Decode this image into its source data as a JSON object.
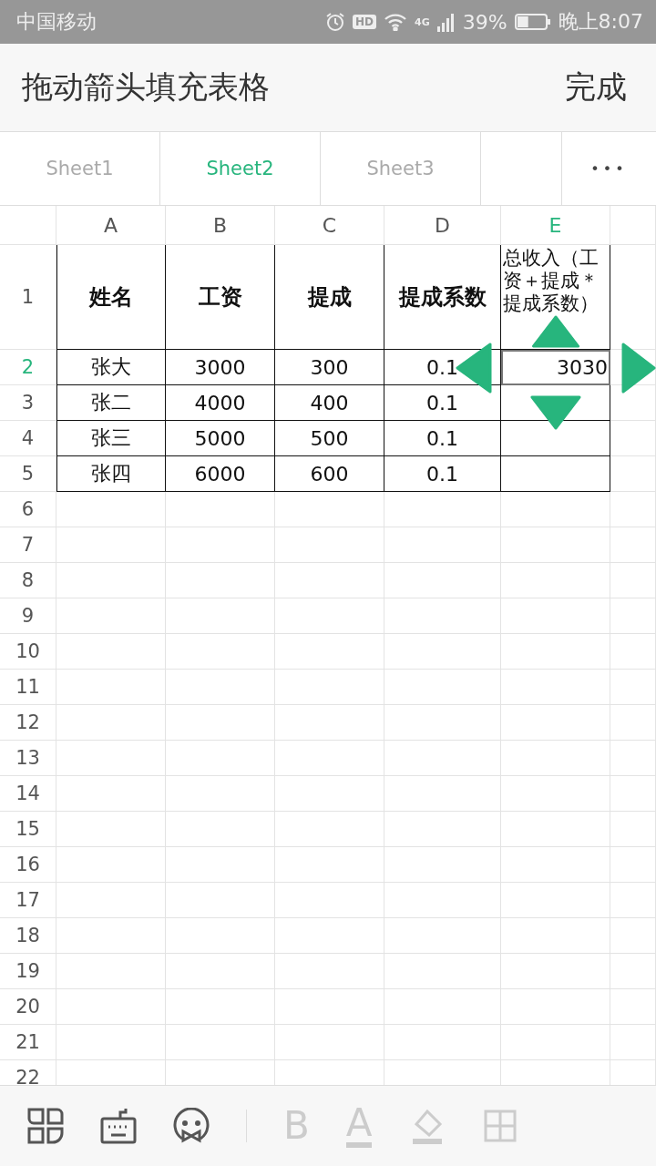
{
  "status_bar": {
    "carrier": "中国移动",
    "hd": "HD",
    "network": "4G",
    "battery_text": "39%",
    "battery": {
      "level": 0.39
    },
    "time": "晚上8:07"
  },
  "header": {
    "title": "拖动箭头填充表格",
    "done": "完成"
  },
  "tabs": [
    {
      "label": "Sheet1",
      "selected": false
    },
    {
      "label": "Sheet2",
      "selected": true
    },
    {
      "label": "Sheet3",
      "selected": false
    }
  ],
  "more": "•••",
  "table": {
    "columns": [
      {
        "label": "A",
        "selected": false
      },
      {
        "label": "B",
        "selected": false
      },
      {
        "label": "C",
        "selected": false
      },
      {
        "label": "D",
        "selected": false
      },
      {
        "label": "E",
        "selected": true
      }
    ],
    "rows": [
      {
        "label": "1",
        "selected": false,
        "bordered": true,
        "kind": "header",
        "cells": [
          {
            "text": "姓名"
          },
          {
            "text": "工资"
          },
          {
            "text": "提成"
          },
          {
            "text": "提成系数"
          },
          {
            "text": "总收入（工资＋提成＊提成系数）"
          }
        ]
      },
      {
        "label": "2",
        "selected": true,
        "bordered": true,
        "kind": "data",
        "cells": [
          {
            "text": "张大"
          },
          {
            "text": "3000"
          },
          {
            "text": "300"
          },
          {
            "text": "0.1"
          },
          {
            "text": "3030",
            "selected": true
          }
        ]
      },
      {
        "label": "3",
        "selected": false,
        "bordered": true,
        "kind": "data",
        "cells": [
          {
            "text": "张二"
          },
          {
            "text": "4000"
          },
          {
            "text": "400"
          },
          {
            "text": "0.1"
          }
        ]
      },
      {
        "label": "4",
        "selected": false,
        "bordered": true,
        "kind": "data",
        "cells": [
          {
            "text": "张三"
          },
          {
            "text": "5000"
          },
          {
            "text": "500"
          },
          {
            "text": "0.1"
          }
        ]
      },
      {
        "label": "5",
        "selected": false,
        "bordered": true,
        "kind": "data",
        "cells": [
          {
            "text": "张四"
          },
          {
            "text": "6000"
          },
          {
            "text": "600"
          },
          {
            "text": "0.1"
          }
        ]
      },
      {
        "label": "6",
        "selected": false,
        "bordered": false,
        "kind": "data",
        "cells": []
      },
      {
        "label": "7",
        "selected": false,
        "bordered": false,
        "kind": "data",
        "cells": []
      },
      {
        "label": "8",
        "selected": false,
        "bordered": false,
        "kind": "data",
        "cells": []
      },
      {
        "label": "9",
        "selected": false,
        "bordered": false,
        "kind": "data",
        "cells": []
      },
      {
        "label": "10",
        "selected": false,
        "bordered": false,
        "kind": "data",
        "cells": []
      },
      {
        "label": "11",
        "selected": false,
        "bordered": false,
        "kind": "data",
        "cells": []
      },
      {
        "label": "12",
        "selected": false,
        "bordered": false,
        "kind": "data",
        "cells": []
      },
      {
        "label": "13",
        "selected": false,
        "bordered": false,
        "kind": "data",
        "cells": []
      },
      {
        "label": "14",
        "selected": false,
        "bordered": false,
        "kind": "data",
        "cells": []
      },
      {
        "label": "15",
        "selected": false,
        "bordered": false,
        "kind": "data",
        "cells": []
      },
      {
        "label": "16",
        "selected": false,
        "bordered": false,
        "kind": "data",
        "cells": []
      },
      {
        "label": "17",
        "selected": false,
        "bordered": false,
        "kind": "data",
        "cells": []
      },
      {
        "label": "18",
        "selected": false,
        "bordered": false,
        "kind": "data",
        "cells": []
      },
      {
        "label": "19",
        "selected": false,
        "bordered": false,
        "kind": "data",
        "cells": []
      },
      {
        "label": "20",
        "selected": false,
        "bordered": false,
        "kind": "data",
        "cells": []
      },
      {
        "label": "21",
        "selected": false,
        "bordered": false,
        "kind": "data",
        "cells": []
      },
      {
        "label": "22",
        "selected": false,
        "bordered": false,
        "kind": "data",
        "cells": []
      }
    ]
  },
  "toolbar": [
    {
      "kind": "icon",
      "disabled": false
    },
    {
      "kind": "icon",
      "disabled": false
    },
    {
      "kind": "icon",
      "disabled": false
    },
    {
      "kind": "separator"
    },
    {
      "kind": "text",
      "label": "B",
      "disabled": true
    },
    {
      "kind": "underlined",
      "label": "A",
      "disabled": true
    },
    {
      "kind": "icon",
      "disabled": true
    },
    {
      "kind": "icon",
      "disabled": true
    }
  ]
}
